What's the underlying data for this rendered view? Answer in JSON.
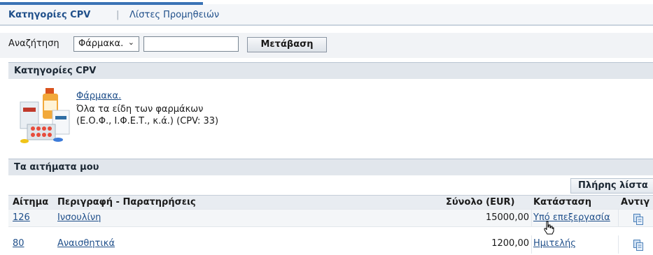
{
  "tabs": {
    "active": "Κατηγορίες CPV",
    "separator": "|",
    "other": "Λίστες Προμηθειών"
  },
  "search": {
    "label": "Αναζήτηση",
    "select_value": "Φάρμακα.",
    "input_value": "",
    "go_label": "Μετάβαση"
  },
  "cpv_section": {
    "header": "Κατηγορίες CPV",
    "item": {
      "link": "Φάρμακα.",
      "description": "Όλα τα είδη των φαρμάκων (Ε.Ο.Φ., Ι.Φ.Ε.Τ., κ.ά.) (CPV: 33)"
    }
  },
  "requests_section": {
    "header": "Τα αιτήματα μου",
    "full_list_label": "Πλήρης λίστα",
    "columns": [
      "Αίτημα",
      "Περιγραφή - Παρατηρήσεις",
      "Σύνολο (EUR)",
      "Κατάσταση",
      "Αντιγ"
    ],
    "rows": [
      {
        "id": "126",
        "description": "Ινσουλίνη",
        "total": "15000,00",
        "status": "Υπό επεξεργασία"
      },
      {
        "id": "80",
        "description": "Αναισθητικά",
        "total": "1200,00",
        "status": "Ημιτελής"
      }
    ]
  },
  "colors": {
    "accent": "#3a73b5",
    "link": "#1f4f8a",
    "header_bg": "#e1e6ec"
  },
  "icons": {
    "select_chevron": "chevron-down-icon",
    "copy": "copy-icon",
    "cursor": "hand-pointer-icon",
    "cpv_image": "medicine-products-image"
  }
}
